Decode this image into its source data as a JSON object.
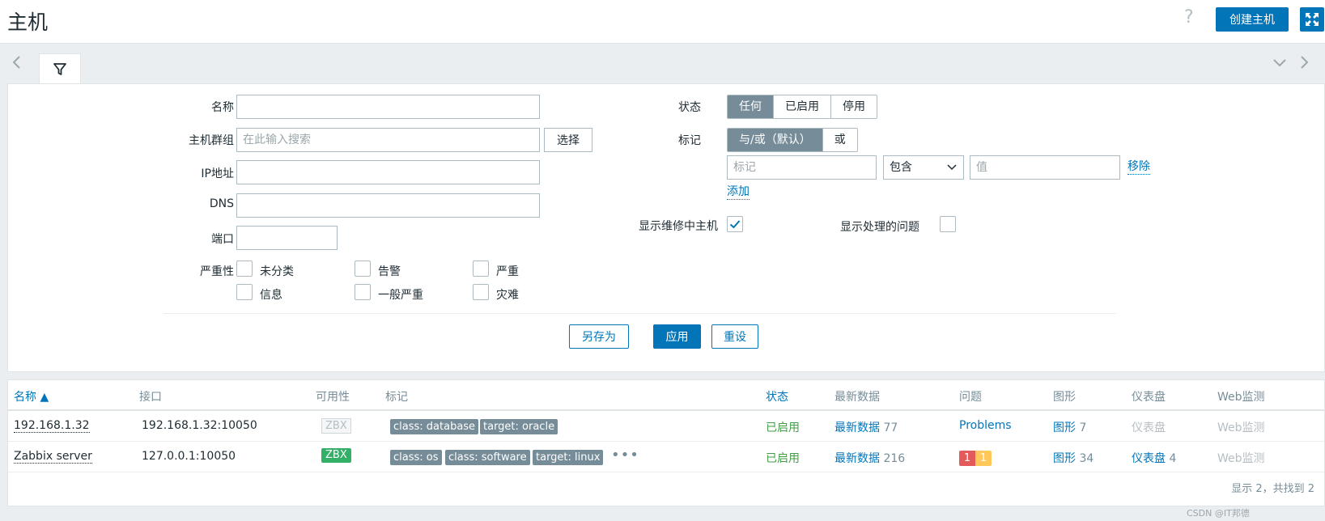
{
  "header": {
    "title": "主机",
    "create_button": "创建主机"
  },
  "filter": {
    "labels": {
      "name": "名称",
      "host_groups": "主机群组",
      "ip": "IP地址",
      "dns": "DNS",
      "port": "端口",
      "severity": "严重性",
      "status": "状态",
      "tags": "标记",
      "show_maintenance": "显示维修中主机",
      "show_suppressed": "显示处理的问题"
    },
    "host_group_placeholder": "在此输入搜索",
    "select_button": "选择",
    "status_options": [
      "任何",
      "已启用",
      "停用"
    ],
    "tag_mode_options": [
      "与/或（默认）",
      "或"
    ],
    "tag_placeholder": "标记",
    "tag_operator": "包含",
    "value_placeholder": "值",
    "remove_link": "移除",
    "add_link": "添加",
    "severities": [
      "未分类",
      "告警",
      "严重",
      "信息",
      "一般严重",
      "灾难"
    ],
    "show_maintenance_checked": true,
    "show_suppressed_checked": false,
    "buttons": {
      "save_as": "另存为",
      "apply": "应用",
      "reset": "重设"
    }
  },
  "table": {
    "headers": [
      "名称 ▲",
      "接口",
      "可用性",
      "标记",
      "状态",
      "最新数据",
      "问题",
      "图形",
      "仪表盘",
      "Web监测"
    ],
    "rows": [
      {
        "name": "192.168.1.32",
        "interface": "192.168.1.32:10050",
        "availability": "ZBX",
        "tags": [
          "class: database",
          "target: oracle"
        ],
        "status": "已启用",
        "latest_label": "最新数据",
        "latest_count": "77",
        "problems": "Problems",
        "graphs_label": "图形",
        "graphs_count": "7",
        "dashboards": "仪表盘",
        "web": "Web监测"
      },
      {
        "name": "Zabbix server",
        "interface": "127.0.0.1:10050",
        "availability": "ZBX",
        "tags": [
          "class: os",
          "class: software",
          "target: linux"
        ],
        "more": "•••",
        "status": "已启用",
        "latest_label": "最新数据",
        "latest_count": "216",
        "problem_high": "1",
        "problem_avg": "1",
        "graphs_label": "图形",
        "graphs_count": "34",
        "dashboards": "仪表盘",
        "dashboards_count": "4",
        "web": "Web监测"
      }
    ],
    "footer": "显示 2，共找到 2"
  },
  "watermark": "CSDN @IT邦德"
}
